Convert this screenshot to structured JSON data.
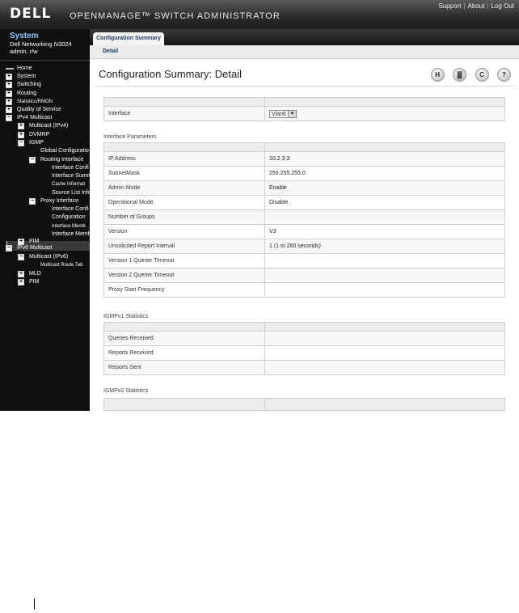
{
  "header": {
    "logo": "DELL",
    "app_title": "OPENMANAGE™ SWITCH ADMINISTRATOR",
    "links": [
      "Support",
      "About",
      "Log Out"
    ]
  },
  "system": {
    "title": "System",
    "device": "Dell Networking N3024",
    "user": "admin, r/w"
  },
  "tree": [
    {
      "label": "Home",
      "kind": "leaf",
      "level": 0
    },
    {
      "label": "System",
      "kind": "plus",
      "level": 0
    },
    {
      "label": "Switching",
      "kind": "plus",
      "level": 0
    },
    {
      "label": "Routing",
      "kind": "plus",
      "level": 0
    },
    {
      "label": "Statistics/RMON",
      "kind": "plus",
      "level": 0,
      "small": true
    },
    {
      "label": "Quality of Service",
      "kind": "plus",
      "level": 0
    },
    {
      "label": "IPv4 Multicast",
      "kind": "minus",
      "level": 0
    },
    {
      "label": "Multicast (IPv4)",
      "kind": "plus",
      "level": 1
    },
    {
      "label": "DVMRP",
      "kind": "plus",
      "level": 1
    },
    {
      "label": "IGMP",
      "kind": "minus",
      "level": 1
    },
    {
      "label": "Global Configuratio",
      "kind": "leaf",
      "level": 2
    },
    {
      "label": "Routing Interface",
      "kind": "minus",
      "level": 2
    },
    {
      "label": "Interface Confi",
      "kind": "leaf",
      "level": 3
    },
    {
      "label": "Interface Summ",
      "kind": "leaf",
      "level": 3
    },
    {
      "label": "Cache Informat",
      "kind": "leaf",
      "level": 3,
      "small": true
    },
    {
      "label": "Source List Info",
      "kind": "leaf",
      "level": 3
    },
    {
      "label": "Proxy Interface",
      "kind": "minus",
      "level": 2
    },
    {
      "label": "Interface Confi",
      "kind": "leaf",
      "level": 3
    },
    {
      "label": "Configuration",
      "kind": "leaf",
      "level": 3,
      "selected": true
    },
    {
      "label": "Interface Memb",
      "kind": "leaf",
      "level": 3,
      "small": true
    },
    {
      "label": "Interface Memb",
      "kind": "leaf",
      "level": 3
    },
    {
      "label": "PIM",
      "kind": "plus",
      "level": 1
    },
    {
      "label": "IPv6 Multicast",
      "kind": "minus",
      "level": 0
    },
    {
      "label": "Multicast (IPv6)",
      "kind": "minus",
      "level": 1
    },
    {
      "label": "Multicast Route Tab",
      "kind": "leaf",
      "level": 2,
      "small": true
    },
    {
      "label": "MLD",
      "kind": "plus",
      "level": 1
    },
    {
      "label": "PIM",
      "kind": "plus",
      "level": 1
    }
  ],
  "tabs": {
    "main": "Configuration Summary",
    "sub": "Detail"
  },
  "page": {
    "title": "Configuration Summary: Detail"
  },
  "toolbar": {
    "icons": [
      "save-icon",
      "print-icon",
      "refresh-icon",
      "help-icon"
    ],
    "save_glyph": "H",
    "print_glyph": "▓",
    "refresh_glyph": "C",
    "help_glyph": "?"
  },
  "interface": {
    "label": "Interface",
    "value": "Vlan6"
  },
  "params": {
    "title": "Interface Parameters",
    "rows": [
      {
        "k": "IP Address",
        "v": "10.2.3.3"
      },
      {
        "k": "SubnetMask",
        "v": "255.255.255.0"
      },
      {
        "k": "Admin Mode",
        "v": "Enable"
      },
      {
        "k": "Operational Mode",
        "v": "Disable"
      },
      {
        "k": "Number of Groups",
        "v": ""
      },
      {
        "k": "Version",
        "v": "V3"
      },
      {
        "k": "Unsolicited Report Interval",
        "v": "1 (1 to 260 seconds)"
      },
      {
        "k": "Version 1 Querier Timeout",
        "v": ""
      },
      {
        "k": "Version 2 Querier Timeout",
        "v": ""
      },
      {
        "k": "Proxy Start Frequency",
        "v": ""
      }
    ]
  },
  "igmpv1": {
    "title": "IGMPv1 Statistics",
    "rows": [
      {
        "k": "Queries Received",
        "v": ""
      },
      {
        "k": "Reports Received",
        "v": ""
      },
      {
        "k": "Reports Sent",
        "v": ""
      }
    ]
  },
  "igmpv2": {
    "title": "IGMPv2 Statistics"
  }
}
